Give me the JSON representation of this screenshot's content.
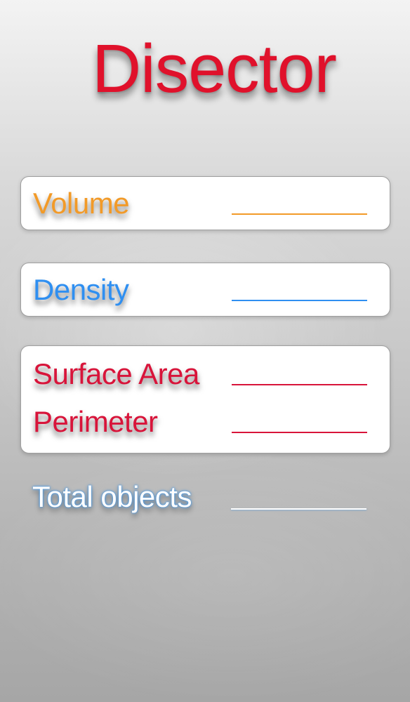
{
  "app": {
    "title": "Disector"
  },
  "measurements": {
    "volume": {
      "label": "Volume",
      "value": "",
      "color": "#f29a28"
    },
    "density": {
      "label": "Density",
      "value": "",
      "color": "#2f8ff1"
    },
    "surface_area": {
      "label": "Surface Area",
      "value": "",
      "color": "#d8143a"
    },
    "perimeter": {
      "label": "Perimeter",
      "value": "",
      "color": "#d8143a"
    },
    "total_objects": {
      "label": "Total objects",
      "value": "",
      "color": "#ffffff"
    }
  }
}
